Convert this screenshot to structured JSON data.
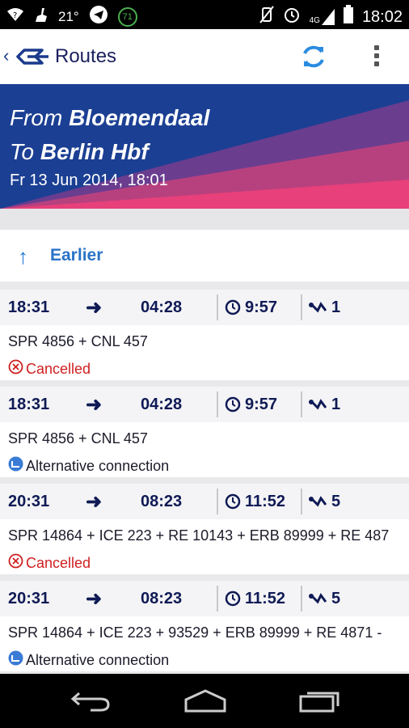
{
  "status_bar": {
    "temperature": "21°",
    "network": "4G",
    "time": "18:02",
    "badge": "71"
  },
  "appbar": {
    "title": "Routes"
  },
  "header": {
    "from_prefix": "From ",
    "from_station": "Bloemendaal",
    "to_prefix": "To ",
    "to_station": "Berlin Hbf",
    "datetime": "Fr 13 Jun 2014, 18:01"
  },
  "earlier": {
    "label": "Earlier"
  },
  "routes": [
    {
      "departure": "18:31",
      "arrival": "04:28",
      "duration": "9:57",
      "changes": "1",
      "trains": "SPR 4856 + CNL 457",
      "status": "Cancelled",
      "status_type": "cancelled"
    },
    {
      "departure": "18:31",
      "arrival": "04:28",
      "duration": "9:57",
      "changes": "1",
      "trains": "SPR 4856 + CNL 457",
      "status": "Alternative connection",
      "status_type": "alternative"
    },
    {
      "departure": "20:31",
      "arrival": "08:23",
      "duration": "11:52",
      "changes": "5",
      "trains": "SPR 14864 + ICE 223 + RE 10143 + ERB 89999 + RE 487",
      "status": "Cancelled",
      "status_type": "cancelled"
    },
    {
      "departure": "20:31",
      "arrival": "08:23",
      "duration": "11:52",
      "changes": "5",
      "trains": "SPR 14864 + ICE 223 + 93529 + ERB 89999 + RE 4871 -",
      "status": "Alternative connection",
      "status_type": "alternative"
    }
  ],
  "colors": {
    "brand_blue": "#1b3f93",
    "accent_pink": "#e8407a",
    "link_blue": "#2a73c8",
    "cancel_red": "#d02020",
    "text_navy": "#0f1a55"
  }
}
